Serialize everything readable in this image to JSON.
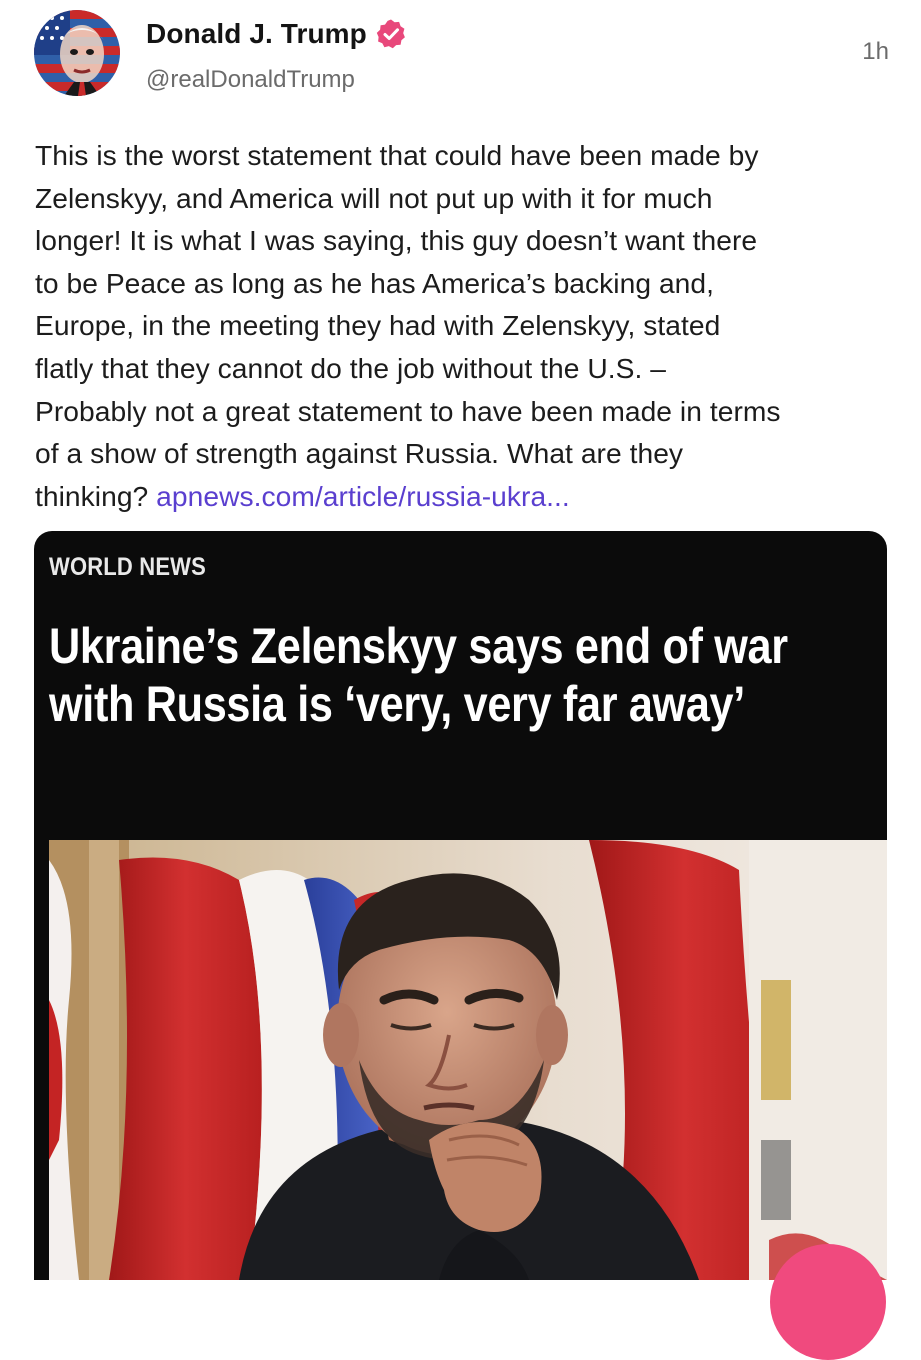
{
  "post": {
    "author": {
      "display_name": "Donald J. Trump",
      "handle": "@realDonaldTrump",
      "verified": true,
      "verified_icon": "verified-badge-icon"
    },
    "timestamp": "1h",
    "text_lines": [
      "This is the worst statement that could have been made by",
      "Zelenskyy, and America will not put up with it for much",
      "longer! It is what I was saying, this guy doesn’t want there",
      "to be Peace as long as he has America’s backing and,",
      "Europe, in the meeting they had with Zelenskyy, stated",
      "flatly that they cannot do the job without the U.S. –",
      "Probably not a great statement to have been made in terms",
      "of a show of strength against Russia. What are they"
    ],
    "text_last_line": "thinking? ",
    "link_text": "apnews.com/article/russia-ukra..."
  },
  "link_card": {
    "section": "WORLD NEWS",
    "headline_line1": "Ukraine’s Zelenskyy says end of war",
    "headline_line2": "with Russia is ‘very, very far away’"
  },
  "colors": {
    "link": "#5a3fcf",
    "verified_badge": "#e8487b",
    "card_background": "#0b0b0b",
    "fab": "#f04a7e"
  }
}
